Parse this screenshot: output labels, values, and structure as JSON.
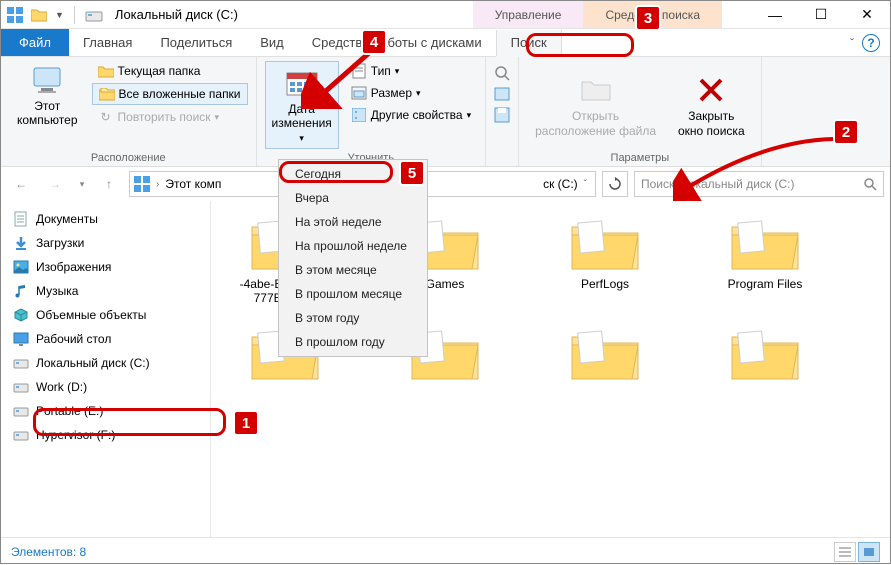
{
  "titlebar": {
    "title": "Локальный диск (C:)"
  },
  "context_tabs": {
    "manage": "Управление",
    "search": "Средства поиска"
  },
  "win": {
    "min": "—",
    "max": "☐",
    "close": "✕"
  },
  "tabs": {
    "file": "Файл",
    "home": "Главная",
    "share": "Поделиться",
    "view": "Вид",
    "disks": "Средства работы с дисками",
    "search": "Поиск"
  },
  "ribbon": {
    "this_pc": "Этот\nкомпьютер",
    "current_folder": "Текущая папка",
    "all_subfolders": "Все вложенные папки",
    "search_again": "Повторить поиск",
    "group_location": "Расположение",
    "date_modified": "Дата\nизменения",
    "type": "Тип",
    "size": "Размер",
    "other_props": "Другие свойства",
    "group_refine": "Уточнить",
    "open_location": "Открыть\nрасположение файла",
    "close_search": "Закрыть\nокно поиска",
    "group_params": "Параметры"
  },
  "dropdown": {
    "today": "Сегодня",
    "yesterday": "Вчера",
    "this_week": "На этой неделе",
    "last_week": "На прошлой неделе",
    "this_month": "В этом месяце",
    "last_month": "В прошлом месяце",
    "this_year": "В этом году",
    "last_year": "В прошлом году"
  },
  "address": {
    "root": "Этот комп",
    "current": "ск (C:)"
  },
  "search": {
    "placeholder": "Поиск: Локальный диск (C:)"
  },
  "sidebar": {
    "items": [
      {
        "label": "Документы",
        "icon": "doc"
      },
      {
        "label": "Загрузки",
        "icon": "down"
      },
      {
        "label": "Изображения",
        "icon": "img"
      },
      {
        "label": "Музыка",
        "icon": "music"
      },
      {
        "label": "Объемные объекты",
        "icon": "3d"
      },
      {
        "label": "Рабочий стол",
        "icon": "desk"
      },
      {
        "label": "Локальный диск (C:)",
        "icon": "drive"
      },
      {
        "label": "Work (D:)",
        "icon": "drive"
      },
      {
        "label": "Portable (E:)",
        "icon": "drive"
      },
      {
        "label": "Hypervisor (F:)",
        "icon": "drive"
      }
    ]
  },
  "folders": [
    {
      "name": "-4abe-B1F4-D6E\n777B1699B"
    },
    {
      "name": "Games"
    },
    {
      "name": "PerfLogs"
    },
    {
      "name": "Program Files"
    },
    {
      "name": ""
    },
    {
      "name": ""
    },
    {
      "name": ""
    },
    {
      "name": ""
    }
  ],
  "status": {
    "count_label": "Элементов: 8"
  },
  "callouts": {
    "b1": "1",
    "b2": "2",
    "b3": "3",
    "b4": "4",
    "b5": "5"
  }
}
